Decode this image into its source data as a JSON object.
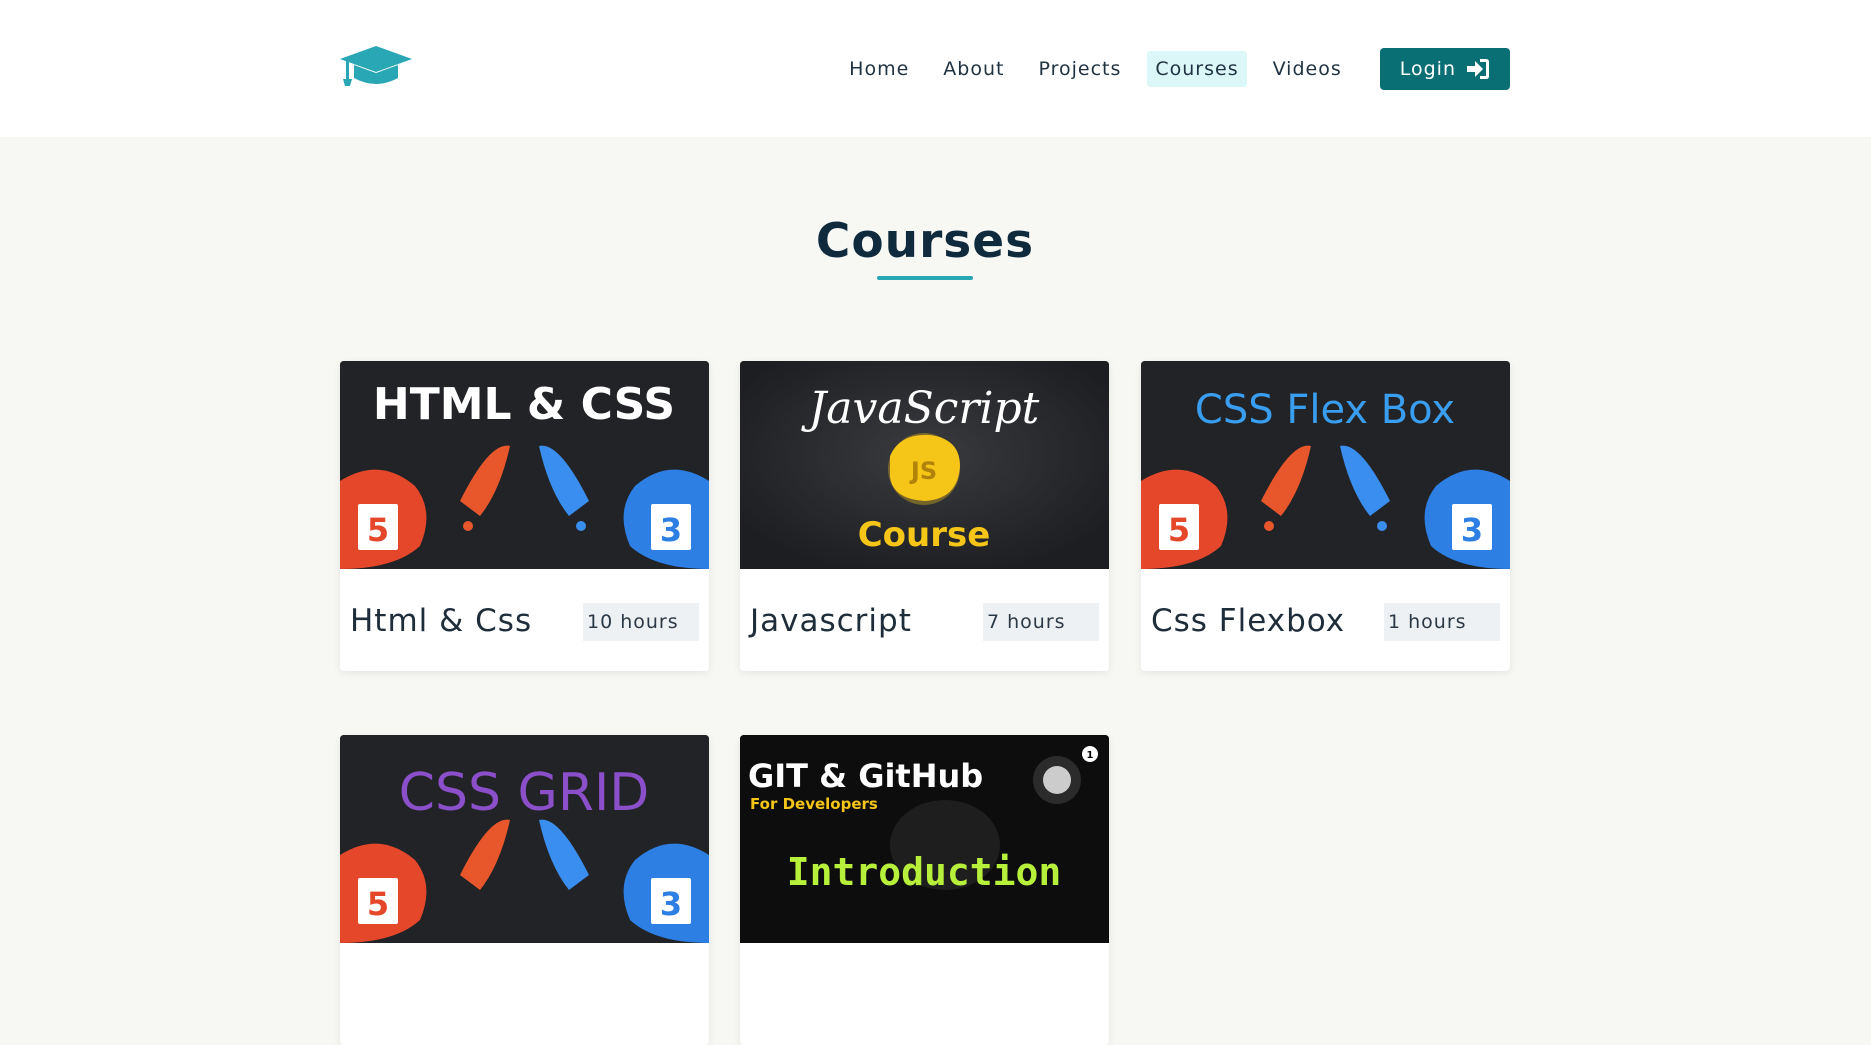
{
  "header": {
    "logo_icon": "graduation-cap-icon",
    "nav": [
      {
        "label": "Home"
      },
      {
        "label": "About"
      },
      {
        "label": "Projects"
      },
      {
        "label": "Courses",
        "active": true
      },
      {
        "label": "Videos"
      }
    ],
    "login_label": "Login",
    "login_icon": "sign-in-icon"
  },
  "main": {
    "title": "Courses",
    "courses": [
      {
        "name": "Html & Css",
        "hours": "10 hours",
        "thumb_text": "HTML & CSS"
      },
      {
        "name": "Javascript",
        "hours": "7 hours",
        "thumb_text": "JavaScript",
        "thumb_sub": "Course"
      },
      {
        "name": "Css Flexbox",
        "hours": "1 hours",
        "thumb_text": "CSS Flex Box"
      },
      {
        "thumb_text": "CSS GRID"
      },
      {
        "thumb_text": "GIT & GitHub",
        "thumb_sub": "For Developers",
        "thumb_sub2": "Introduction",
        "thumb_badge": "1"
      }
    ]
  },
  "colors": {
    "accent": "#2aa7b5",
    "login_bg": "#0a6e75",
    "page_bg": "#f7f7f3",
    "nav_active_bg": "#dcf7f8"
  }
}
